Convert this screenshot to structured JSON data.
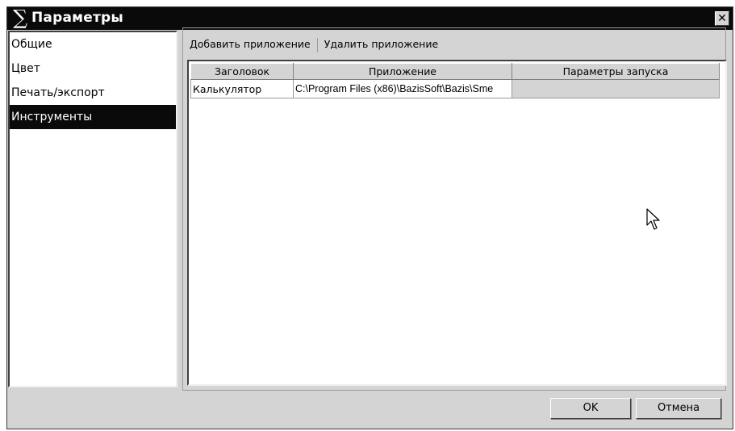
{
  "window": {
    "title": "Параметры",
    "icon": "sigma-icon",
    "close_icon": "close-icon"
  },
  "sidebar": {
    "items": [
      {
        "label": "Общие",
        "selected": false
      },
      {
        "label": "Цвет",
        "selected": false
      },
      {
        "label": "Печать/экспорт",
        "selected": false
      },
      {
        "label": "Инструменты",
        "selected": true
      }
    ]
  },
  "toolbar": {
    "add_label": "Добавить приложение",
    "remove_label": "Удалить приложение"
  },
  "grid": {
    "columns": [
      "Заголовок",
      "Приложение",
      "Параметры запуска"
    ],
    "rows": [
      {
        "title": "Калькулятор",
        "app": "C:\\Program Files (x86)\\BazisSoft\\Bazis\\Sme",
        "params": ""
      }
    ]
  },
  "footer": {
    "ok_label": "OK",
    "cancel_label": "Отмена"
  },
  "colors": {
    "titlebar": "#0a0a0a",
    "selection": "#0a0a0a",
    "dialog_bg": "#d4d4d4"
  }
}
